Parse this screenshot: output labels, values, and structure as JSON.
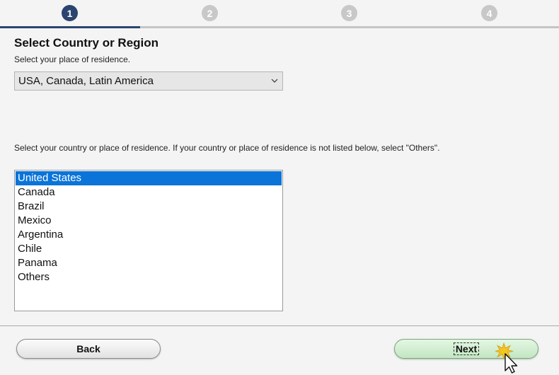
{
  "steps": {
    "items": [
      {
        "number": "1",
        "state": "active"
      },
      {
        "number": "2",
        "state": "inactive"
      },
      {
        "number": "3",
        "state": "inactive"
      },
      {
        "number": "4",
        "state": "inactive"
      }
    ],
    "active_color": "#2b4470",
    "inactive_color": "#c8c8c8"
  },
  "header": {
    "title": "Select Country or Region",
    "subtitle": "Select your place of residence."
  },
  "region_select": {
    "value": "USA, Canada, Latin America",
    "icon": "chevron-down-icon"
  },
  "instruction": "Select your country or place of residence. If your country or place of residence is not listed below, select \"Others\".",
  "country_list": {
    "selected_index": 0,
    "selected_color": "#0a74d9",
    "items": [
      "United States",
      "Canada",
      "Brazil",
      "Mexico",
      "Argentina",
      "Chile",
      "Panama",
      "Others"
    ]
  },
  "footer": {
    "back_label": "Back",
    "next_label": "Next"
  },
  "cursor": {
    "icon": "pointer-cursor-icon"
  }
}
